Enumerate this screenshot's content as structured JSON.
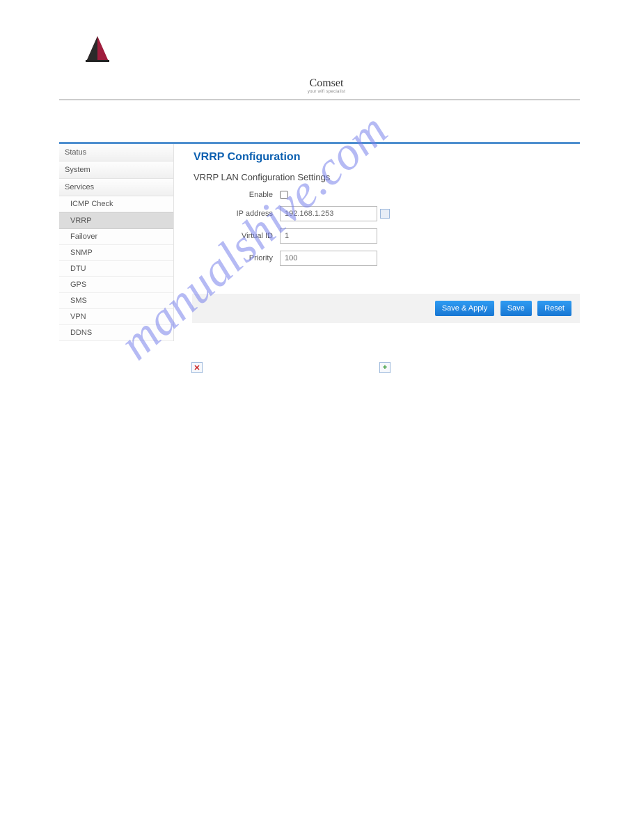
{
  "brand": {
    "name": "Comset",
    "tagline": "your wifi specialist"
  },
  "sidebar": {
    "items": [
      {
        "label": "Status",
        "type": "top"
      },
      {
        "label": "System",
        "type": "top"
      },
      {
        "label": "Services",
        "type": "top"
      },
      {
        "label": "ICMP Check",
        "type": "sub"
      },
      {
        "label": "VRRP",
        "type": "sub",
        "active": true
      },
      {
        "label": "Failover",
        "type": "sub"
      },
      {
        "label": "SNMP",
        "type": "sub"
      },
      {
        "label": "DTU",
        "type": "sub"
      },
      {
        "label": "GPS",
        "type": "sub"
      },
      {
        "label": "SMS",
        "type": "sub"
      },
      {
        "label": "VPN",
        "type": "sub"
      },
      {
        "label": "DDNS",
        "type": "sub"
      }
    ]
  },
  "main": {
    "title": "VRRP Configuration",
    "section": "VRRP LAN Configuration Settings",
    "fields": {
      "enable_label": "Enable",
      "enable_checked": false,
      "ip_label": "IP address",
      "ip_value": "192.168.1.253",
      "vid_label": "Virtual ID",
      "vid_value": "1",
      "priority_label": "Priority",
      "priority_value": "100"
    },
    "buttons": {
      "save_apply": "Save & Apply",
      "save": "Save",
      "reset": "Reset"
    }
  },
  "watermark": "manualshive.com",
  "badges": {
    "x": "✕",
    "plus": "+"
  }
}
